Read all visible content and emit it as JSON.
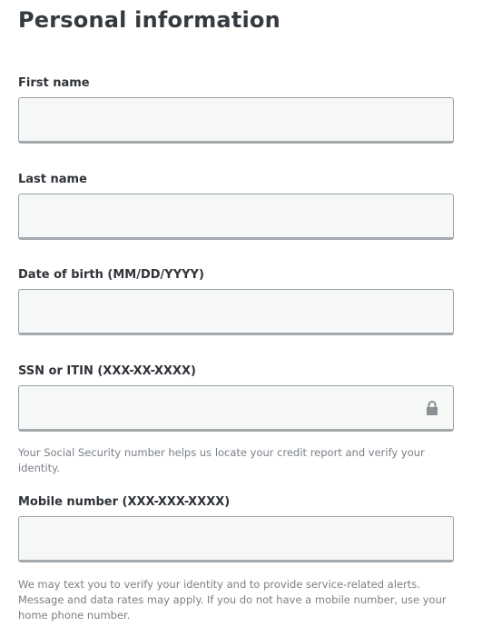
{
  "page": {
    "title": "Personal information"
  },
  "fields": {
    "first_name": {
      "label": "First name",
      "value": ""
    },
    "last_name": {
      "label": "Last name",
      "value": ""
    },
    "dob": {
      "label": "Date of birth (MM/DD/YYYY)",
      "value": ""
    },
    "ssn": {
      "label": "SSN or ITIN (XXX-XX-XXXX)",
      "value": "",
      "icon": "lock-icon",
      "help": "Your Social Security number helps us locate your credit report and verify your identity."
    },
    "mobile": {
      "label": "Mobile number (XXX-XXX-XXXX)",
      "value": "",
      "help": "We may text you to verify your identity and to provide service-related alerts. Message and data rates may apply. If you do not have a mobile number, use your home phone number."
    }
  },
  "colors": {
    "input_background": "#f6f7f7",
    "input_border": "#9aa0a6",
    "title_text": "#343a40",
    "help_text": "#7a8087"
  }
}
